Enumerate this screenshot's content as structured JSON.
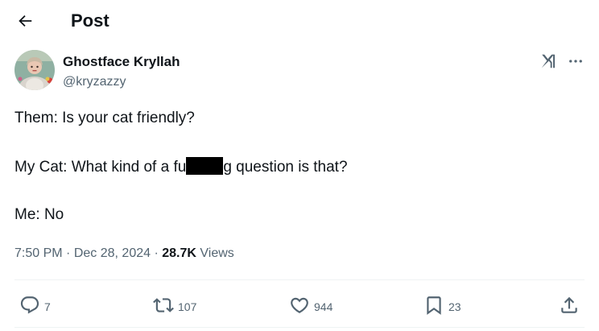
{
  "header": {
    "title": "Post",
    "back_icon": "arrow-left-icon"
  },
  "post": {
    "author": {
      "name": "Ghostface Kryllah",
      "handle": "@kryzazzy"
    },
    "text": {
      "line1": "Them: Is your cat friendly?",
      "line2_before": "My Cat: What kind of a fu",
      "line2_after": "g question is that?",
      "line3": "Me: No"
    },
    "meta": {
      "time": "7:50 PM",
      "separator": "·",
      "date": "Dec 28, 2024",
      "views_count": "28.7K",
      "views_label": "Views"
    },
    "actions": {
      "replies": "7",
      "reposts": "107",
      "likes": "944",
      "bookmarks": "23"
    }
  },
  "icons": [
    "arrow-left-icon",
    "grok-icon",
    "more-icon",
    "reply-icon",
    "repost-icon",
    "like-icon",
    "bookmark-icon",
    "share-icon"
  ],
  "colors": {
    "text_primary": "#0f1419",
    "text_secondary": "#536471",
    "divider": "#eff3f4",
    "censor_bar": "#000000"
  }
}
